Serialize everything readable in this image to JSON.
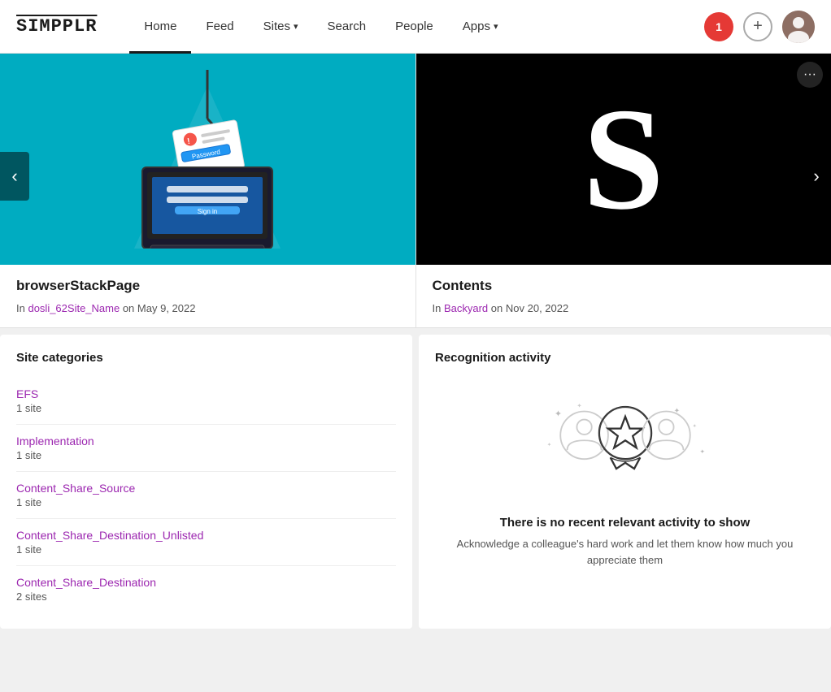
{
  "header": {
    "logo": "SIMPPLR",
    "nav": [
      {
        "label": "Home",
        "active": true
      },
      {
        "label": "Feed",
        "active": false
      },
      {
        "label": "Sites",
        "active": false,
        "hasDropdown": true
      },
      {
        "label": "Search",
        "active": false
      },
      {
        "label": "People",
        "active": false
      },
      {
        "label": "Apps",
        "active": false,
        "hasDropdown": true
      }
    ],
    "notification_count": "1",
    "add_button_label": "+",
    "avatar_emoji": "👤"
  },
  "carousel": {
    "prev_label": "‹",
    "next_label": "›",
    "cards": [
      {
        "title": "browserStackPage",
        "meta_prefix": "In",
        "site_name": "dosli_62Site_Name",
        "date_prefix": "on",
        "date": "May 9, 2022"
      },
      {
        "title": "Contents",
        "meta_prefix": "In",
        "site_name": "Backyard",
        "date_prefix": "on",
        "date": "Nov 20, 2022",
        "more_icon": "•••"
      }
    ]
  },
  "site_categories": {
    "panel_title": "Site categories",
    "items": [
      {
        "label": "EFS",
        "count": "1 site"
      },
      {
        "label": "Implementation",
        "count": "1 site"
      },
      {
        "label": "Content_Share_Source",
        "count": "1 site"
      },
      {
        "label": "Content_Share_Destination_Unlisted",
        "count": "1 site"
      },
      {
        "label": "Content_Share_Destination",
        "count": "2 sites"
      }
    ]
  },
  "recognition": {
    "panel_title": "Recognition activity",
    "main_text": "There is no recent relevant activity to show",
    "sub_text": "Acknowledge a colleague's hard work and let them know how much you appreciate them"
  },
  "colors": {
    "purple_link": "#9c27b0",
    "teal_bg": "#00acc1",
    "notification_red": "#e53935"
  }
}
